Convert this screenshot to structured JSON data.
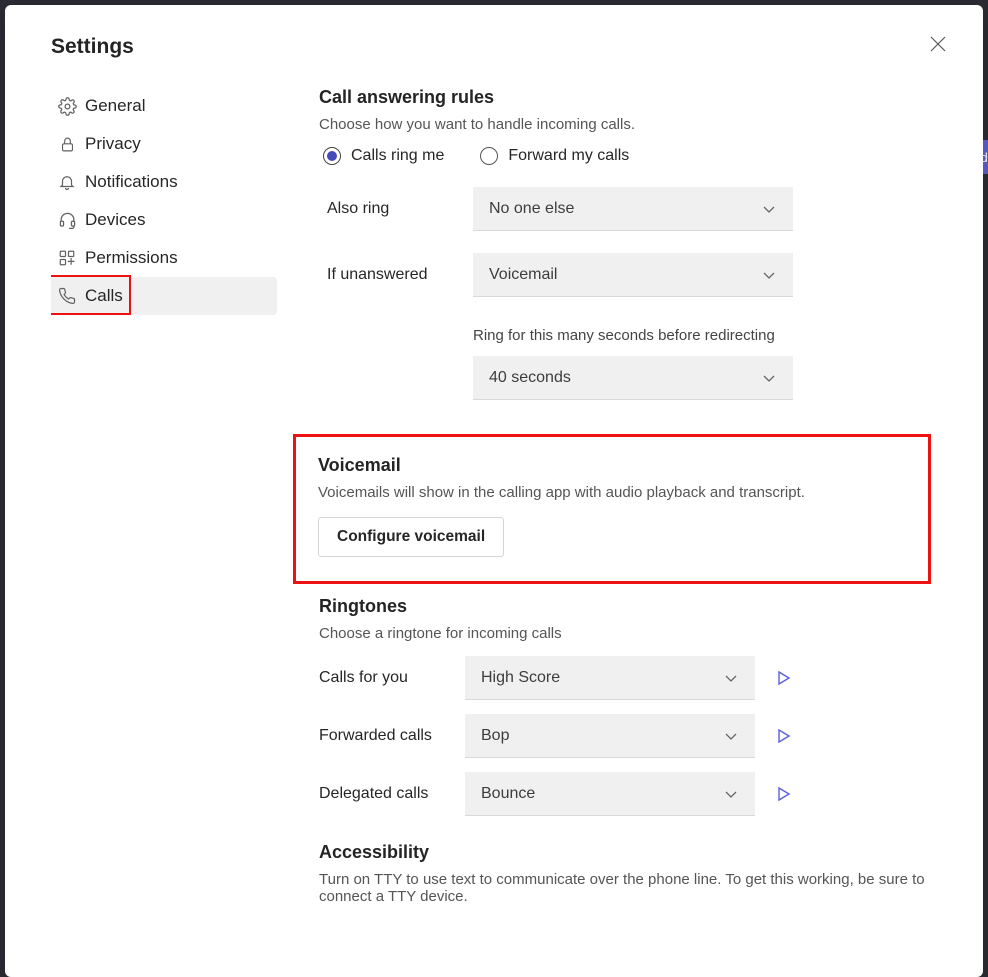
{
  "behindTag": "eed",
  "title": "Settings",
  "sidebar": {
    "items": [
      {
        "label": "General"
      },
      {
        "label": "Privacy"
      },
      {
        "label": "Notifications"
      },
      {
        "label": "Devices"
      },
      {
        "label": "Permissions"
      },
      {
        "label": "Calls"
      }
    ]
  },
  "sections": {
    "answering": {
      "title": "Call answering rules",
      "sub": "Choose how you want to handle incoming calls.",
      "radio_ring": "Calls ring me",
      "radio_forward": "Forward my calls",
      "also_ring_label": "Also ring",
      "also_ring_value": "No one else",
      "unanswered_label": "If unanswered",
      "unanswered_value": "Voicemail",
      "ring_for_label": "Ring for this many seconds before redirecting",
      "ring_for_value": "40 seconds"
    },
    "voicemail": {
      "title": "Voicemail",
      "sub": "Voicemails will show in the calling app with audio playback and transcript.",
      "button": "Configure voicemail"
    },
    "ringtones": {
      "title": "Ringtones",
      "sub": "Choose a ringtone for incoming calls",
      "rows": [
        {
          "label": "Calls for you",
          "value": "High Score"
        },
        {
          "label": "Forwarded calls",
          "value": "Bop"
        },
        {
          "label": "Delegated calls",
          "value": "Bounce"
        }
      ]
    },
    "accessibility": {
      "title": "Accessibility",
      "sub": "Turn on TTY to use text to communicate over the phone line. To get this working, be sure to connect a TTY device."
    }
  }
}
